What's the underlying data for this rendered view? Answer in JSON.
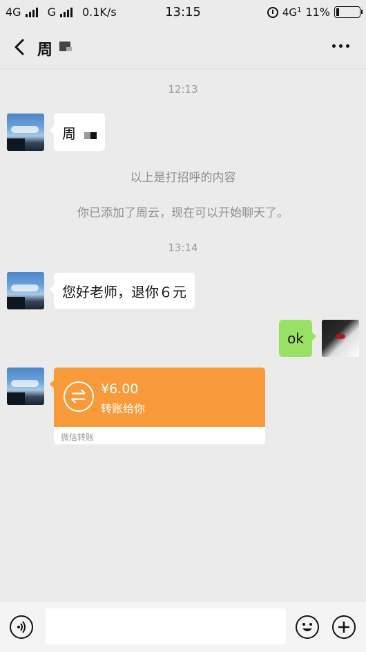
{
  "status_bar": {
    "network1": "4G",
    "network2": "G",
    "speed": "0.1K/s",
    "time": "13:15",
    "network3": "4G",
    "network3_sub": "1",
    "battery": "11%"
  },
  "header": {
    "title": "周"
  },
  "chat": {
    "time1": "12:13",
    "msg1": "周",
    "system1": "以上是打招呼的内容",
    "system2": "你已添加了周云，现在可以开始聊天了。",
    "time2": "13:14",
    "msg2": "您好老师，退你６元",
    "msg3": "ok",
    "transfer": {
      "amount": "¥6.00",
      "description": "转账给你",
      "footer": "微信转账"
    }
  },
  "colors": {
    "background": "#ebebeb",
    "sent_bubble": "#98e165",
    "transfer_orange": "#f89a3a"
  },
  "icons": {
    "back": "back-arrow-icon",
    "more": "more-icon",
    "voice": "voice-icon",
    "emoji": "emoji-icon",
    "plus": "plus-icon",
    "transfer": "transfer-icon"
  }
}
